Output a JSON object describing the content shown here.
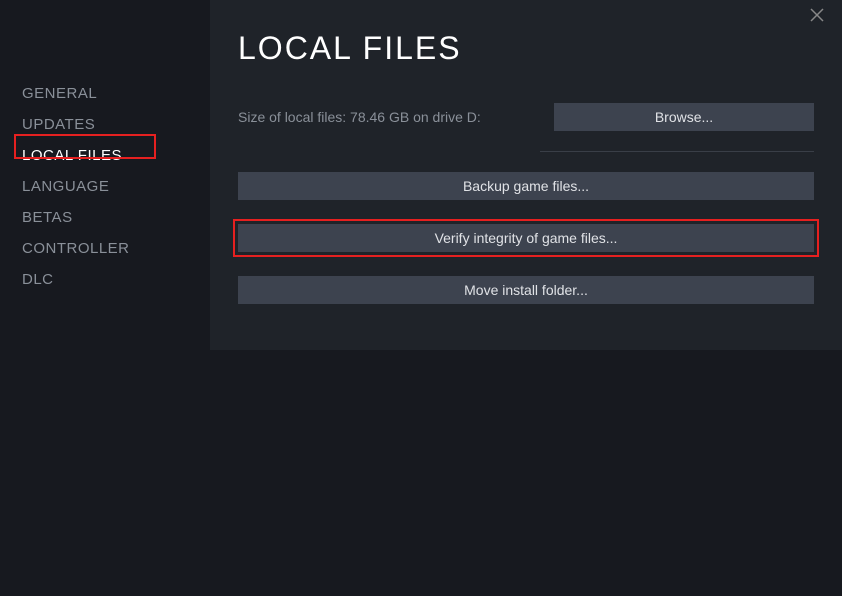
{
  "sidebar": {
    "items": [
      {
        "label": "GENERAL"
      },
      {
        "label": "UPDATES"
      },
      {
        "label": "LOCAL FILES"
      },
      {
        "label": "LANGUAGE"
      },
      {
        "label": "BETAS"
      },
      {
        "label": "CONTROLLER"
      },
      {
        "label": "DLC"
      }
    ]
  },
  "content": {
    "title": "LOCAL FILES",
    "size_text": "Size of local files: 78.46 GB on drive D:",
    "browse_label": "Browse...",
    "backup_label": "Backup game files...",
    "verify_label": "Verify integrity of game files...",
    "move_label": "Move install folder..."
  }
}
